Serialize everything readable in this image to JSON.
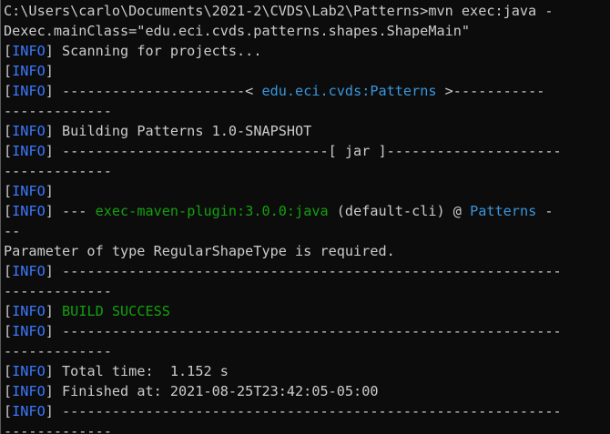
{
  "terminal": {
    "colors": {
      "background": "#0c0c0c",
      "text": "#cccccc",
      "info": "#3b78ff",
      "success": "#13a10e",
      "project": "#3a96dd"
    },
    "lines": [
      [
        [
          "w",
          "C:\\Users\\carlo\\Documents\\2021-2\\CVDS\\Lab2\\Patterns>mvn exec:java -"
        ]
      ],
      [
        [
          "w",
          "Dexec.mainClass=\"edu.eci.cvds.patterns.shapes.ShapeMain\""
        ]
      ],
      [
        [
          "w",
          "["
        ],
        [
          "b",
          "INFO"
        ],
        [
          "w",
          "] Scanning for projects..."
        ]
      ],
      [
        [
          "w",
          "["
        ],
        [
          "b",
          "INFO"
        ],
        [
          "w",
          "]"
        ]
      ],
      [
        [
          "w",
          "["
        ],
        [
          "b",
          "INFO"
        ],
        [
          "w",
          "] ----------------------< "
        ],
        [
          "c",
          "edu.eci.cvds:Patterns"
        ],
        [
          "w",
          " >-----------"
        ]
      ],
      [
        [
          "w",
          "-------------"
        ]
      ],
      [
        [
          "w",
          "["
        ],
        [
          "b",
          "INFO"
        ],
        [
          "w",
          "] Building Patterns 1.0-SNAPSHOT"
        ]
      ],
      [
        [
          "w",
          "["
        ],
        [
          "b",
          "INFO"
        ],
        [
          "w",
          "] --------------------------------[ jar ]---------------------"
        ]
      ],
      [
        [
          "w",
          "-------------"
        ]
      ],
      [
        [
          "w",
          "["
        ],
        [
          "b",
          "INFO"
        ],
        [
          "w",
          "]"
        ]
      ],
      [
        [
          "w",
          "["
        ],
        [
          "b",
          "INFO"
        ],
        [
          "w",
          "] --- "
        ],
        [
          "g",
          "exec-maven-plugin:3.0.0:java"
        ],
        [
          "w",
          " (default-cli) @ "
        ],
        [
          "c",
          "Patterns"
        ],
        [
          "w",
          " -"
        ]
      ],
      [
        [
          "w",
          "--"
        ]
      ],
      [
        [
          "w",
          "Parameter of type RegularShapeType is required."
        ]
      ],
      [
        [
          "w",
          "["
        ],
        [
          "b",
          "INFO"
        ],
        [
          "w",
          "] ------------------------------------------------------------"
        ]
      ],
      [
        [
          "w",
          "-------------"
        ]
      ],
      [
        [
          "w",
          "["
        ],
        [
          "b",
          "INFO"
        ],
        [
          "w",
          "] "
        ],
        [
          "g",
          "BUILD SUCCESS"
        ]
      ],
      [
        [
          "w",
          "["
        ],
        [
          "b",
          "INFO"
        ],
        [
          "w",
          "] ------------------------------------------------------------"
        ]
      ],
      [
        [
          "w",
          "-------------"
        ]
      ],
      [
        [
          "w",
          "["
        ],
        [
          "b",
          "INFO"
        ],
        [
          "w",
          "] Total time:  1.152 s"
        ]
      ],
      [
        [
          "w",
          "["
        ],
        [
          "b",
          "INFO"
        ],
        [
          "w",
          "] Finished at: 2021-08-25T23:42:05-05:00"
        ]
      ],
      [
        [
          "w",
          "["
        ],
        [
          "b",
          "INFO"
        ],
        [
          "w",
          "] ------------------------------------------------------------"
        ]
      ],
      [
        [
          "w",
          "-------------"
        ]
      ]
    ]
  }
}
